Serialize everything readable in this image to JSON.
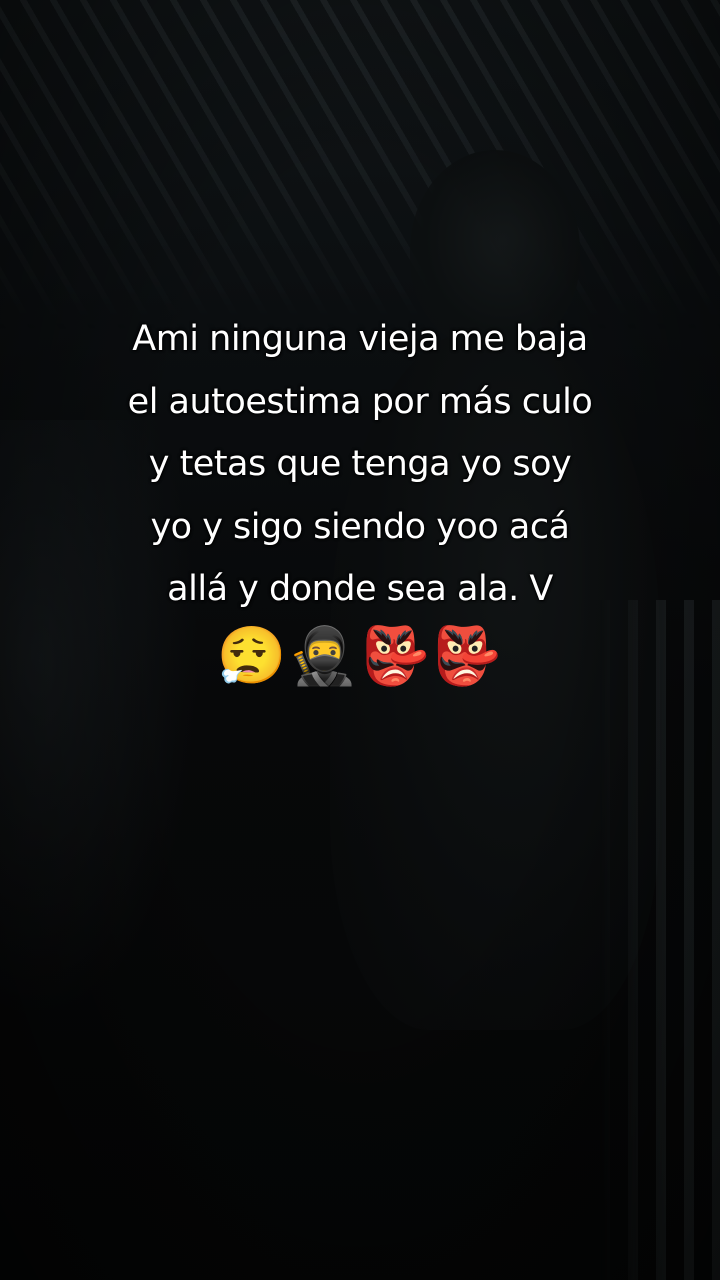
{
  "caption": {
    "lines": [
      "Ami ninguna vieja me baja",
      "el autoestima por más culo",
      "y tetas que tenga yo soy",
      "yo y sigo siendo yoo acá",
      "allá y donde sea ala. V"
    ],
    "emojis": "😮‍💨🥷👺👺"
  },
  "colors": {
    "text": "#ffffff",
    "background": "#060708"
  }
}
